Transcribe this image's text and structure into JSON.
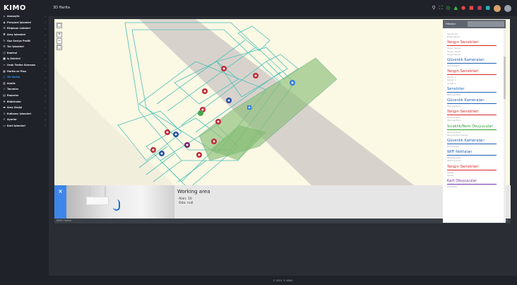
{
  "app": {
    "logo": "KIMO",
    "page_title": "3D Harita"
  },
  "sidebar": {
    "items": [
      {
        "label": "Anasayfa",
        "icon": "home-icon",
        "glyph": "⌂"
      },
      {
        "label": "Personel İşlemleri",
        "icon": "users-icon",
        "glyph": "♟"
      },
      {
        "label": "Ekipman Listeleri",
        "icon": "list-icon",
        "glyph": "☰"
      },
      {
        "label": "Araç İşlemleri",
        "icon": "filter-icon",
        "glyph": "▼"
      },
      {
        "label": "Gaz Seviye Profili",
        "icon": "gas-icon",
        "glyph": "✎"
      },
      {
        "label": "Tur İşlemleri",
        "icon": "settings-icon",
        "glyph": "⚙"
      },
      {
        "label": "Kontrol",
        "icon": "clock-icon",
        "glyph": "◷"
      },
      {
        "label": "İş Emirleri",
        "icon": "video-icon",
        "glyph": "■"
      },
      {
        "label": "Ocak Teslim Alınması",
        "icon": "signal-icon",
        "glyph": "≈"
      },
      {
        "label": "Harita ve Plan",
        "icon": "map-icon",
        "glyph": "▦"
      },
      {
        "label": "3D Harita",
        "icon": "cube-icon",
        "glyph": "◫",
        "active": true
      },
      {
        "label": "Analiz",
        "icon": "chart-icon",
        "glyph": "▥"
      },
      {
        "label": "Tanımlar",
        "icon": "wrench-icon",
        "glyph": "✓"
      },
      {
        "label": "Raporlar",
        "icon": "file-icon",
        "glyph": "▤"
      },
      {
        "label": "Bildirimler",
        "icon": "bell-icon",
        "glyph": "♦"
      },
      {
        "label": "Araç Geçişi",
        "icon": "car-icon",
        "glyph": "▬"
      },
      {
        "label": "Kullanıcı İşlemleri",
        "icon": "user-settings-icon",
        "glyph": "♙"
      },
      {
        "label": "Ayarlar",
        "icon": "tools-icon",
        "glyph": "✔"
      },
      {
        "label": "Kart İşlemleri",
        "icon": "card-icon",
        "glyph": "▭"
      }
    ]
  },
  "map": {
    "zoom_in": "+",
    "zoom_out": "−",
    "fullscreen": "□",
    "collapse": "«"
  },
  "info_panel": {
    "close": "×",
    "heading": "Working area",
    "rows": [
      {
        "label": "Alan",
        "value": "10"
      },
      {
        "label": "Oda",
        "value": "null"
      }
    ],
    "footer_left": "KİMO Harita",
    "footer_right": "0.11  |  1:1"
  },
  "right_panel": {
    "tab_label": "Filtreler",
    "groups": [
      {
        "title": "",
        "color": "#999999",
        "rows": [
          "Sensör Adı",
          "Dahili Sensör"
        ]
      },
      {
        "title": "Yangın Sensörleri",
        "color": "#d62828",
        "rows": [
          "Yangın Sensör",
          "Yangın Sensör",
          "Yangın Sensör"
        ]
      },
      {
        "title": "Güvenlik Kameraları",
        "color": "#1f5fb5",
        "rows": [
          "Ana Kamera"
        ]
      },
      {
        "title": "Yangın Sensörleri",
        "color": "#d62828",
        "rows": [
          "Sensör 1",
          "Sensör 2",
          "Sensör 3"
        ]
      },
      {
        "title": "Sensörler",
        "color": "#1f5fb5",
        "rows": [
          "Working Point"
        ]
      },
      {
        "title": "Güvenlik Kameraları",
        "color": "#1f5fb5",
        "rows": [
          "Working Point"
        ]
      },
      {
        "title": "Yangın Sensörleri",
        "color": "#d62828",
        "rows": [
          "Working Point",
          "Working Point"
        ]
      },
      {
        "title": "Sıcaklık/Nem Okuyucular",
        "color": "#2e9e3a",
        "rows": [
          "Working Point",
          "Working Point Sensör"
        ]
      },
      {
        "title": "Güvenlik Kameraları",
        "color": "#1f5fb5",
        "rows": [
          "Ana Kamera"
        ]
      },
      {
        "title": "WiFi Noktaları",
        "color": "#1f5fb5",
        "rows": [
          "Working point",
          "Working point"
        ]
      },
      {
        "title": "Yangın Sensörleri",
        "color": "#d62828",
        "rows": [
          "Sensör",
          "Sensör"
        ]
      },
      {
        "title": "Kart Okuyucular",
        "color": "#7a2fa3",
        "rows": [
          "Giriş Kartı"
        ]
      }
    ]
  },
  "footer": {
    "copyright": "© 2021 © KİMO"
  }
}
